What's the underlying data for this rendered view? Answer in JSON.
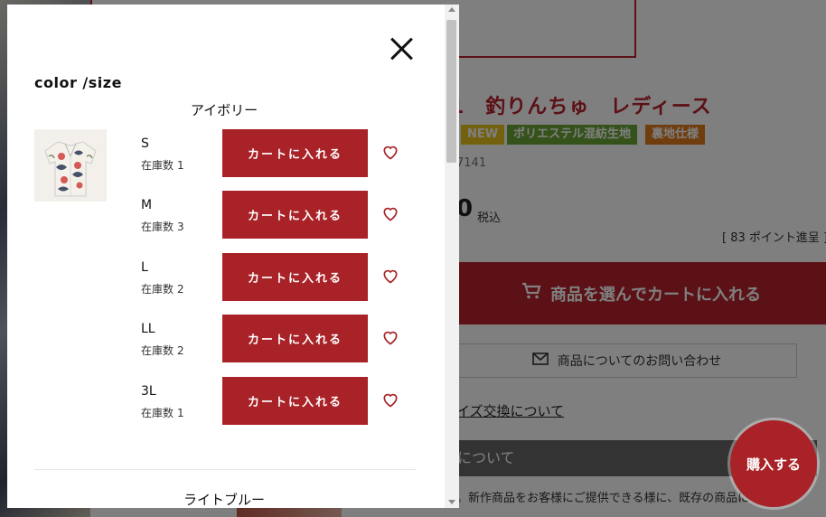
{
  "background": {
    "product_title": "1　釣りんちゅ　レディース",
    "tags": [
      "NEW",
      "ポリエステル混紡生地",
      "裏地仕様"
    ],
    "product_code": "7141",
    "price_partial": "0",
    "tax_label": "税込",
    "points": "[ 83 ポイント進呈 ]",
    "cart_button_label": "商品を選んでカートに入れる",
    "inquiry_label": "商品についてのお問い合わせ",
    "size_exchange_link": "イズ交換について",
    "section_heading": "について",
    "notice_text": "。新作商品をお客様にご提供できる様に、既存の商品に",
    "buy_button_label": "購入する"
  },
  "modal": {
    "title": "color /size",
    "colors": [
      {
        "name": "アイボリー",
        "sizes": [
          {
            "size": "S",
            "stock_label": "在庫数",
            "stock": "1",
            "button": "カートに入れる"
          },
          {
            "size": "M",
            "stock_label": "在庫数",
            "stock": "3",
            "button": "カートに入れる"
          },
          {
            "size": "L",
            "stock_label": "在庫数",
            "stock": "2",
            "button": "カートに入れる"
          },
          {
            "size": "LL",
            "stock_label": "在庫数",
            "stock": "2",
            "button": "カートに入れる"
          },
          {
            "size": "3L",
            "stock_label": "在庫数",
            "stock": "1",
            "button": "カートに入れる"
          }
        ]
      },
      {
        "name": "ライトブルー"
      }
    ]
  },
  "icons": {
    "close": "close-icon",
    "favorite": "heart-outline-icon",
    "cart": "cart-icon",
    "mail": "mail-icon"
  },
  "colors": {
    "accent": "#a82227",
    "tag_new": "#e8c21c",
    "tag_poly": "#6aa536",
    "tag_lining": "#e07b1e"
  }
}
